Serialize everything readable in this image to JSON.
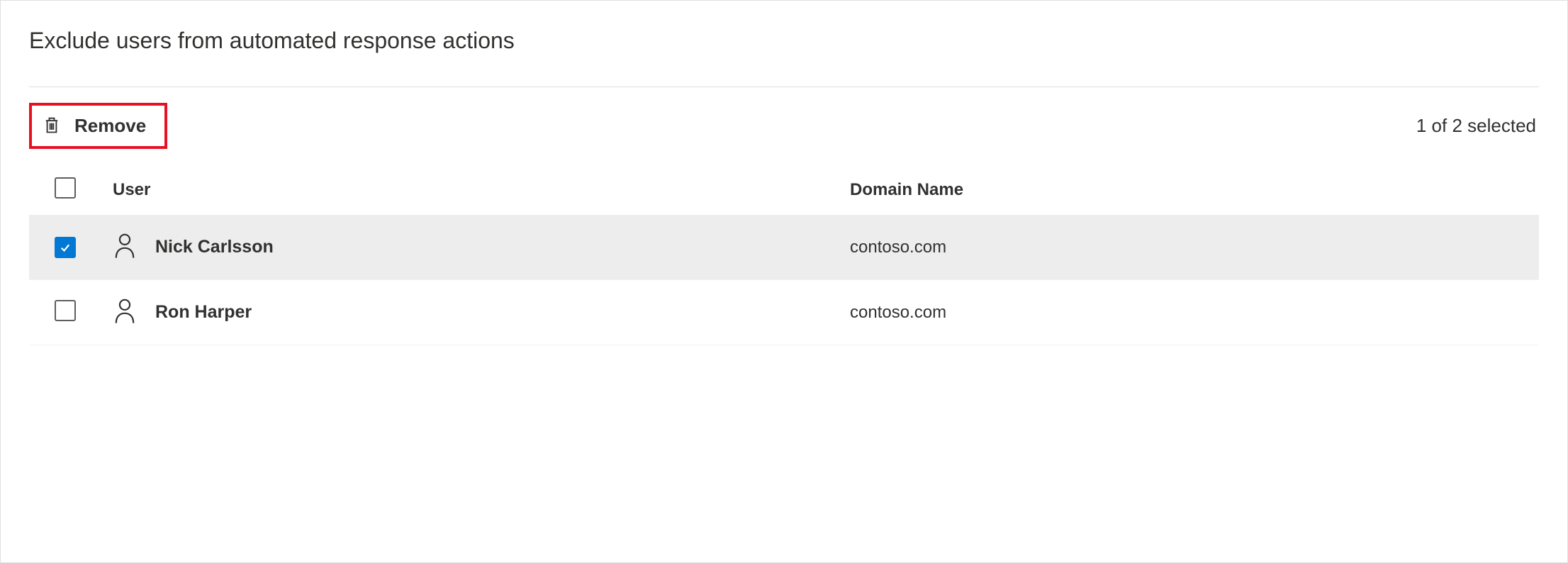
{
  "header": {
    "title": "Exclude users from automated response actions"
  },
  "toolbar": {
    "remove_label": "Remove",
    "selection_text": "1 of 2 selected"
  },
  "table": {
    "columns": {
      "user": "User",
      "domain": "Domain Name"
    },
    "rows": [
      {
        "selected": true,
        "name": "Nick Carlsson",
        "domain": "contoso.com"
      },
      {
        "selected": false,
        "name": "Ron Harper",
        "domain": "contoso.com"
      }
    ]
  }
}
